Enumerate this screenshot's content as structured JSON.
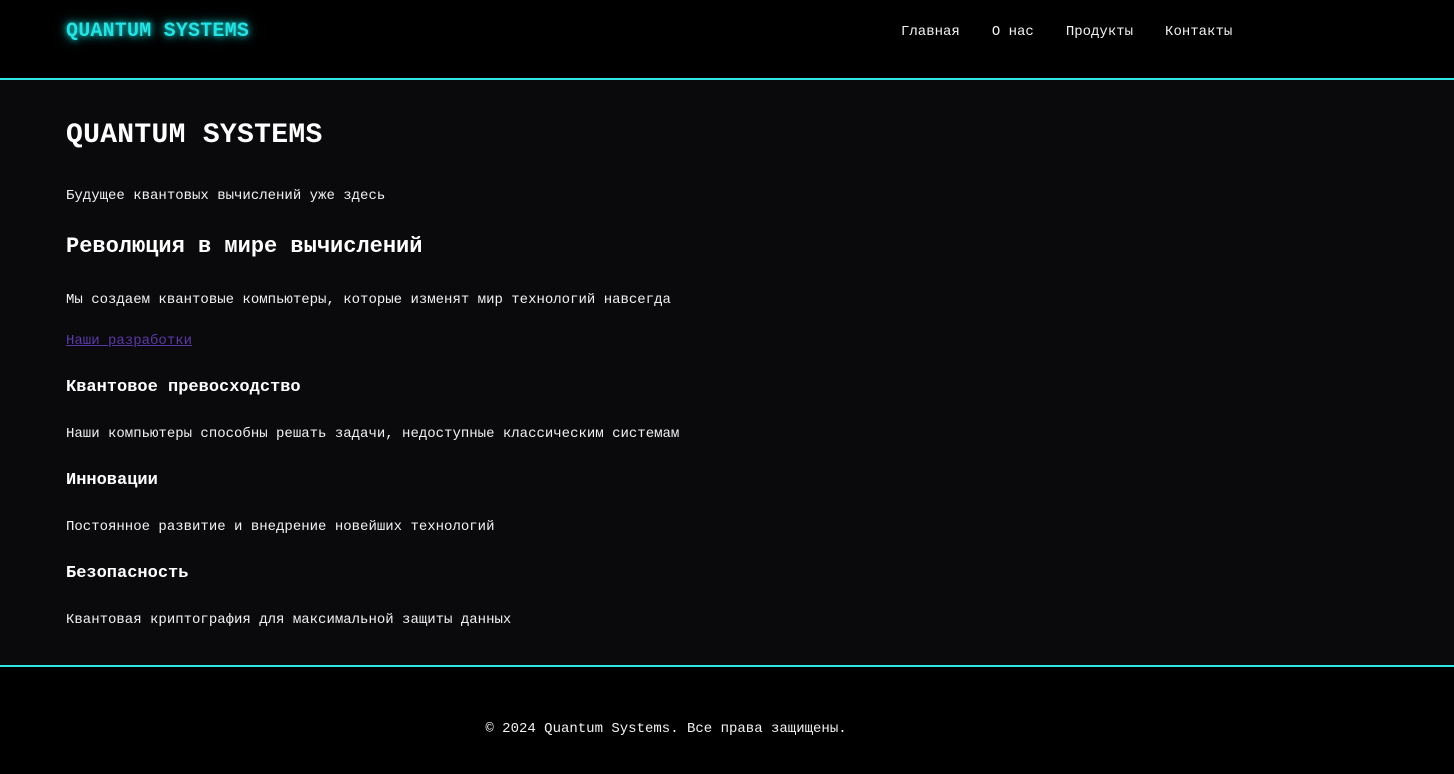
{
  "header": {
    "logo": "QUANTUM SYSTEMS",
    "nav": [
      {
        "label": "Главная"
      },
      {
        "label": "О нас"
      },
      {
        "label": "Продукты"
      },
      {
        "label": "Контакты"
      }
    ]
  },
  "hero": {
    "title": "QUANTUM SYSTEMS",
    "tagline": "Будущее квантовых вычислений уже здесь"
  },
  "intro": {
    "heading": "Революция в мире вычислений",
    "text": "Мы создаем квантовые компьютеры, которые изменят мир технологий навсегда",
    "link": "Наши разработки"
  },
  "features": [
    {
      "title": "Квантовое превосходство",
      "text": "Наши компьютеры способны решать задачи, недоступные классическим системам"
    },
    {
      "title": "Инновации",
      "text": "Постоянное развитие и внедрение новейших технологий"
    },
    {
      "title": "Безопасность",
      "text": "Квантовая криптография для максимальной защиты данных"
    }
  ],
  "footer": {
    "copyright": "© 2024 Quantum Systems. Все права защищены."
  },
  "colors": {
    "accent": "#2ee6e6",
    "link": "#5a3aa6",
    "background": "#0a090c",
    "header_bg": "#000000"
  }
}
